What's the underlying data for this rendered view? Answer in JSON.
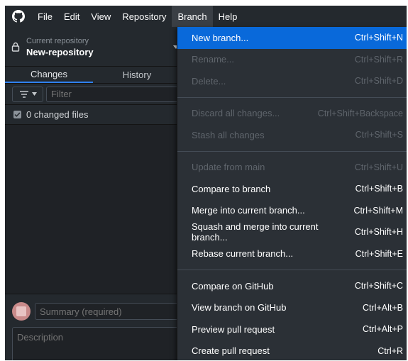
{
  "menubar": {
    "items": [
      "File",
      "Edit",
      "View",
      "Repository",
      "Branch",
      "Help"
    ],
    "active": "Branch"
  },
  "repository": {
    "caption": "Current repository",
    "name": "New-repository"
  },
  "tabs": [
    "Changes",
    "History"
  ],
  "filter": {
    "placeholder": "Filter"
  },
  "changes": {
    "label": "0 changed files"
  },
  "commit": {
    "summary_placeholder": "Summary (required)",
    "description_placeholder": "Description"
  },
  "branch_menu": {
    "groups": [
      [
        {
          "label": "New branch...",
          "shortcut": "Ctrl+Shift+N",
          "state": "highlighted"
        },
        {
          "label": "Rename...",
          "shortcut": "Ctrl+Shift+R",
          "state": "disabled"
        },
        {
          "label": "Delete...",
          "shortcut": "Ctrl+Shift+D",
          "state": "disabled"
        }
      ],
      [
        {
          "label": "Discard all changes...",
          "shortcut": "Ctrl+Shift+Backspace",
          "state": "disabled"
        },
        {
          "label": "Stash all changes",
          "shortcut": "Ctrl+Shift+S",
          "state": "disabled"
        }
      ],
      [
        {
          "label": "Update from main",
          "shortcut": "Ctrl+Shift+U",
          "state": "disabled"
        },
        {
          "label": "Compare to branch",
          "shortcut": "Ctrl+Shift+B",
          "state": "enabled"
        },
        {
          "label": "Merge into current branch...",
          "shortcut": "Ctrl+Shift+M",
          "state": "enabled"
        },
        {
          "label": "Squash and merge into current branch...",
          "shortcut": "Ctrl+Shift+H",
          "state": "enabled"
        },
        {
          "label": "Rebase current branch...",
          "shortcut": "Ctrl+Shift+E",
          "state": "enabled"
        }
      ],
      [
        {
          "label": "Compare on GitHub",
          "shortcut": "Ctrl+Shift+C",
          "state": "enabled"
        },
        {
          "label": "View branch on GitHub",
          "shortcut": "Ctrl+Alt+B",
          "state": "enabled"
        },
        {
          "label": "Preview pull request",
          "shortcut": "Ctrl+Alt+P",
          "state": "enabled"
        },
        {
          "label": "Create pull request",
          "shortcut": "Ctrl+R",
          "state": "enabled"
        }
      ]
    ]
  },
  "colors": {
    "background": "#24292e",
    "menu_background": "#2b3036",
    "highlight": "#0969da",
    "disabled_text": "#5f656c",
    "tab_underline": "#2f81f7"
  },
  "icons": [
    "github-logo-icon",
    "lock-icon",
    "chevron-down-icon",
    "filter-icon",
    "checkbox-icon"
  ]
}
